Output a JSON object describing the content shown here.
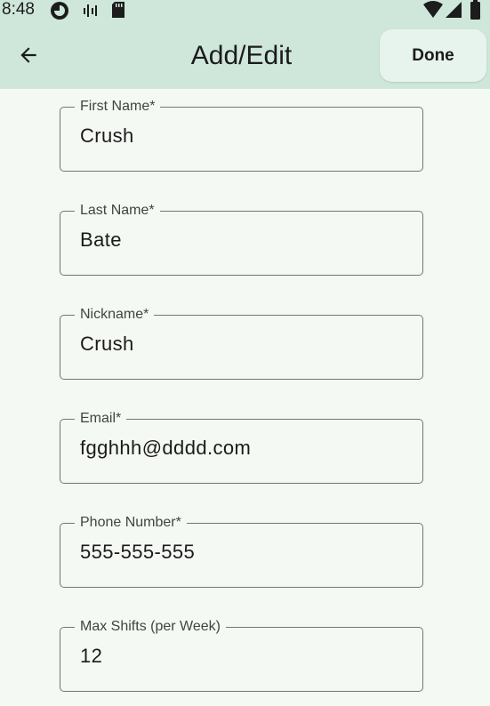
{
  "status_bar": {
    "time": "8:48",
    "left_icons": [
      "data-saver-icon",
      "signal-activity-icon",
      "sd-card-icon"
    ],
    "right_icons": [
      "wifi-icon",
      "cellular-signal-icon",
      "battery-icon"
    ]
  },
  "app_bar": {
    "back_icon": "arrow-left-icon",
    "title": "Add/Edit",
    "done_label": "Done"
  },
  "form": {
    "fields": [
      {
        "label": "First Name*",
        "value": "Crush"
      },
      {
        "label": "Last Name*",
        "value": "Bate"
      },
      {
        "label": "Nickname*",
        "value": "Crush"
      },
      {
        "label": "Email*",
        "value": "fgghhh@dddd.com"
      },
      {
        "label": "Phone Number*",
        "value": "555-555-555"
      },
      {
        "label": "Max Shifts (per Week)",
        "value": "12"
      }
    ]
  },
  "colors": {
    "header_bg": "#cfe7db",
    "page_bg": "#f5f9f3",
    "button_bg": "#e7f4ee",
    "outline": "#6f7870"
  }
}
